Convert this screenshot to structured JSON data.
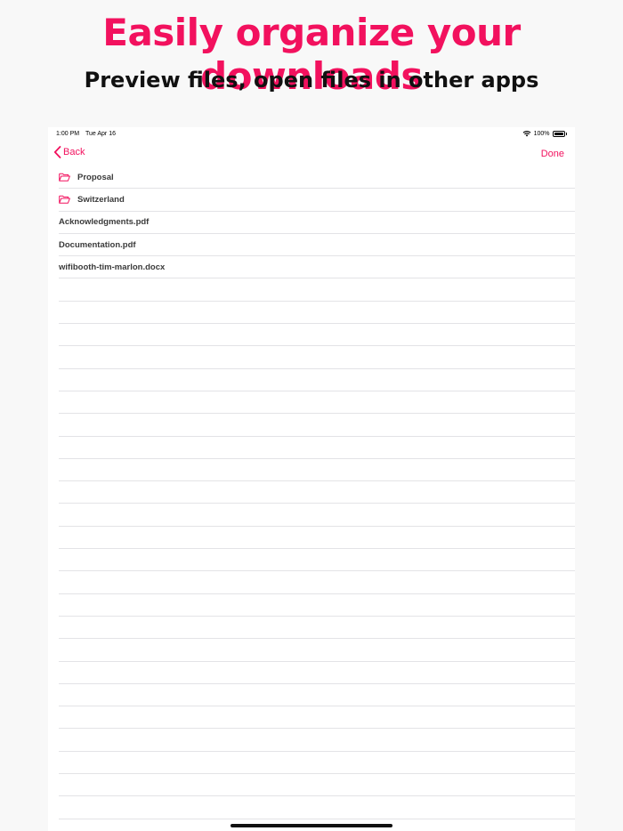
{
  "headline": "Easily organize your downloads",
  "subheadline": "Preview files, open files in other apps",
  "status_bar": {
    "time": "1:00 PM",
    "date": "Tue Apr 16",
    "battery": "100%"
  },
  "nav": {
    "back_label": "Back",
    "done_label": "Done"
  },
  "items": [
    {
      "name": "Proposal",
      "type": "folder",
      "icon": "folder-icon"
    },
    {
      "name": "Switzerland",
      "type": "folder",
      "icon": "folder-icon"
    },
    {
      "name": "Acknowledgments.pdf",
      "type": "file"
    },
    {
      "name": "Documentation.pdf",
      "type": "file"
    },
    {
      "name": "wifibooth-tim-marlon.docx",
      "type": "file"
    }
  ],
  "colors": {
    "accent": "#f2115e",
    "background": "#f8f8f8"
  }
}
